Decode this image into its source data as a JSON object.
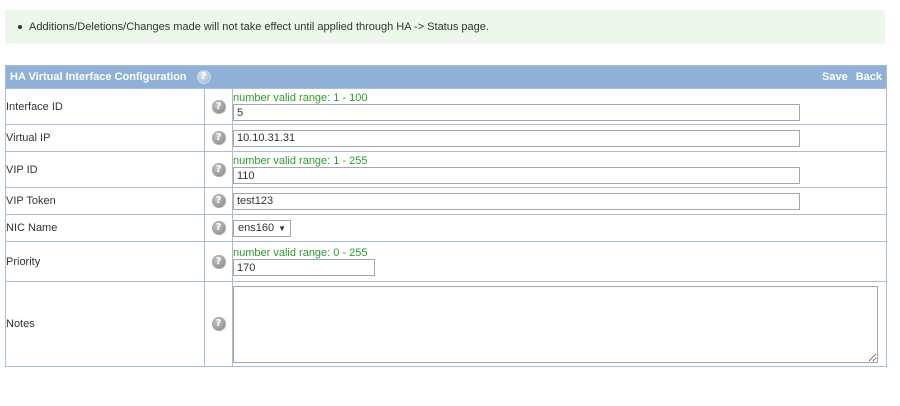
{
  "notice": {
    "text": "Additions/Deletions/Changes made will not take effect until applied through HA -> Status page."
  },
  "header": {
    "title": "HA Virtual Interface Configuration",
    "save_label": "Save",
    "back_label": "Back",
    "help_icon": "?"
  },
  "rows": {
    "interface_id": {
      "label": "Interface ID",
      "range": "number valid range: 1 - 100",
      "value": "5"
    },
    "virtual_ip": {
      "label": "Virtual IP",
      "value": "10.10.31.31"
    },
    "vip_id": {
      "label": "VIP ID",
      "range": "number valid range: 1 - 255",
      "value": "110"
    },
    "vip_token": {
      "label": "VIP Token",
      "value": "test123"
    },
    "nic_name": {
      "label": "NIC Name",
      "value": "ens160",
      "chevron": "▼"
    },
    "priority": {
      "label": "Priority",
      "range": "number valid range: 0 - 255",
      "value": "170"
    },
    "notes": {
      "label": "Notes",
      "value": ""
    }
  },
  "help_glyph": "?",
  "colors": {
    "header_bg": "#8fb1d8",
    "border": "#a9bfd6",
    "notice_bg": "#eef7ec",
    "range_text": "#2d9b2d"
  }
}
